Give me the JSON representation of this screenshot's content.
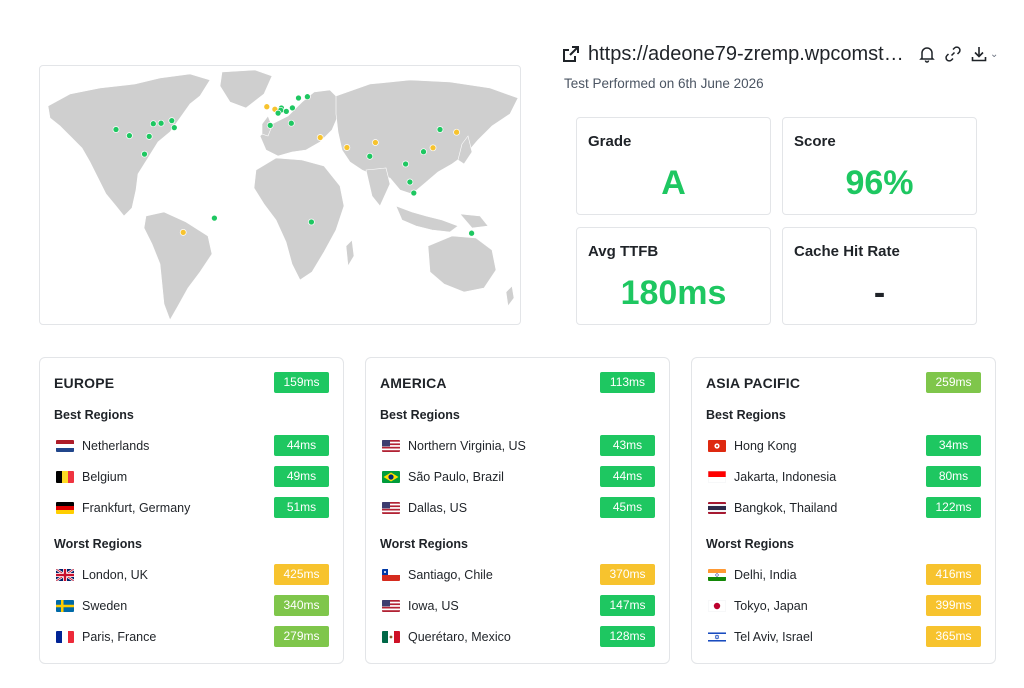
{
  "header": {
    "url": "https://adeone79-zremp.wpcomstagin...",
    "test_date": "Test Performed on 6th June 2026"
  },
  "icons": {
    "external_link": "external-link-icon",
    "bell": "bell-icon",
    "link": "link-icon",
    "download": "download-icon",
    "chevron": "chevron-down-icon"
  },
  "stats": {
    "grade": {
      "label": "Grade",
      "value": "A"
    },
    "score": {
      "label": "Score",
      "value": "96%"
    },
    "ttfb": {
      "label": "Avg TTFB",
      "value": "180ms"
    },
    "cache": {
      "label": "Cache Hit Rate",
      "value": "-"
    }
  },
  "colors": {
    "green": "#1ec761",
    "light_green": "#7fc64b",
    "amber": "#f7c32e",
    "land": "#cfcfcf"
  },
  "map": {
    "markers": [
      {
        "lon": -122.3,
        "lat": 37.6,
        "status": "good"
      },
      {
        "lon": -96.8,
        "lat": 32.8,
        "status": "good"
      },
      {
        "lon": -77.5,
        "lat": 38.9,
        "status": "good"
      },
      {
        "lon": -87.6,
        "lat": 41.9,
        "status": "good"
      },
      {
        "lon": -93.6,
        "lat": 41.6,
        "status": "good"
      },
      {
        "lon": -79.4,
        "lat": 43.7,
        "status": "good"
      },
      {
        "lon": -112.0,
        "lat": 33.4,
        "status": "good"
      },
      {
        "lon": -100.4,
        "lat": 20.6,
        "status": "good"
      },
      {
        "lon": -46.6,
        "lat": -23.5,
        "status": "good"
      },
      {
        "lon": -70.6,
        "lat": -33.4,
        "status": "warn"
      },
      {
        "lon": 4.9,
        "lat": 52.4,
        "status": "good"
      },
      {
        "lon": 4.4,
        "lat": 50.8,
        "status": "good"
      },
      {
        "lon": 8.7,
        "lat": 50.1,
        "status": "good"
      },
      {
        "lon": -0.1,
        "lat": 51.5,
        "status": "warn"
      },
      {
        "lon": 18.1,
        "lat": 59.3,
        "status": "good"
      },
      {
        "lon": 2.35,
        "lat": 48.9,
        "status": "good"
      },
      {
        "lon": 13.4,
        "lat": 52.5,
        "status": "good"
      },
      {
        "lon": 24.9,
        "lat": 60.2,
        "status": "good"
      },
      {
        "lon": -6.3,
        "lat": 53.3,
        "status": "warn"
      },
      {
        "lon": 12.5,
        "lat": 41.9,
        "status": "good"
      },
      {
        "lon": -3.7,
        "lat": 40.4,
        "status": "good"
      },
      {
        "lon": 34.8,
        "lat": 32.1,
        "status": "warn"
      },
      {
        "lon": 55.3,
        "lat": 25.2,
        "status": "warn"
      },
      {
        "lon": 77.2,
        "lat": 28.6,
        "status": "warn"
      },
      {
        "lon": 72.9,
        "lat": 19.1,
        "status": "good"
      },
      {
        "lon": 100.5,
        "lat": 13.8,
        "status": "good"
      },
      {
        "lon": 106.8,
        "lat": -6.2,
        "status": "good"
      },
      {
        "lon": 103.8,
        "lat": 1.35,
        "status": "good"
      },
      {
        "lon": 114.2,
        "lat": 22.3,
        "status": "good"
      },
      {
        "lon": 121.5,
        "lat": 25.0,
        "status": "warn"
      },
      {
        "lon": 126.9,
        "lat": 37.6,
        "status": "good"
      },
      {
        "lon": 139.7,
        "lat": 35.7,
        "status": "warn"
      },
      {
        "lon": 28.0,
        "lat": -26.2,
        "status": "good"
      },
      {
        "lon": 151.2,
        "lat": -33.9,
        "status": "good"
      }
    ]
  },
  "regions": [
    {
      "title": "EUROPE",
      "avg": "159ms",
      "avg_color": "#1ec761",
      "best_label": "Best Regions",
      "worst_label": "Worst Regions",
      "best": [
        {
          "name": "Netherlands",
          "value": "44ms",
          "color": "#1ec761",
          "flag": "netherlands-flag-icon"
        },
        {
          "name": "Belgium",
          "value": "49ms",
          "color": "#1ec761",
          "flag": "belgium-flag-icon"
        },
        {
          "name": "Frankfurt, Germany",
          "value": "51ms",
          "color": "#1ec761",
          "flag": "germany-flag-icon"
        }
      ],
      "worst": [
        {
          "name": "London, UK",
          "value": "425ms",
          "color": "#f7c32e",
          "flag": "uk-flag-icon"
        },
        {
          "name": "Sweden",
          "value": "340ms",
          "color": "#7fc64b",
          "flag": "sweden-flag-icon"
        },
        {
          "name": "Paris, France",
          "value": "279ms",
          "color": "#7fc64b",
          "flag": "france-flag-icon"
        }
      ]
    },
    {
      "title": "AMERICA",
      "avg": "113ms",
      "avg_color": "#1ec761",
      "best_label": "Best Regions",
      "worst_label": "Worst Regions",
      "best": [
        {
          "name": "Northern Virginia, US",
          "value": "43ms",
          "color": "#1ec761",
          "flag": "us-flag-icon"
        },
        {
          "name": "São Paulo, Brazil",
          "value": "44ms",
          "color": "#1ec761",
          "flag": "brazil-flag-icon"
        },
        {
          "name": "Dallas, US",
          "value": "45ms",
          "color": "#1ec761",
          "flag": "us-flag-icon"
        }
      ],
      "worst": [
        {
          "name": "Santiago, Chile",
          "value": "370ms",
          "color": "#f7c32e",
          "flag": "chile-flag-icon"
        },
        {
          "name": "Iowa, US",
          "value": "147ms",
          "color": "#1ec761",
          "flag": "us-flag-icon"
        },
        {
          "name": "Querétaro, Mexico",
          "value": "128ms",
          "color": "#1ec761",
          "flag": "mexico-flag-icon"
        }
      ]
    },
    {
      "title": "ASIA PACIFIC",
      "avg": "259ms",
      "avg_color": "#7fc64b",
      "best_label": "Best Regions",
      "worst_label": "Worst Regions",
      "best": [
        {
          "name": "Hong Kong",
          "value": "34ms",
          "color": "#1ec761",
          "flag": "hong-kong-flag-icon"
        },
        {
          "name": "Jakarta, Indonesia",
          "value": "80ms",
          "color": "#1ec761",
          "flag": "indonesia-flag-icon"
        },
        {
          "name": "Bangkok, Thailand",
          "value": "122ms",
          "color": "#1ec761",
          "flag": "thailand-flag-icon"
        }
      ],
      "worst": [
        {
          "name": "Delhi, India",
          "value": "416ms",
          "color": "#f7c32e",
          "flag": "india-flag-icon"
        },
        {
          "name": "Tokyo, Japan",
          "value": "399ms",
          "color": "#f7c32e",
          "flag": "japan-flag-icon"
        },
        {
          "name": "Tel Aviv, Israel",
          "value": "365ms",
          "color": "#f7c32e",
          "flag": "israel-flag-icon"
        }
      ]
    }
  ]
}
